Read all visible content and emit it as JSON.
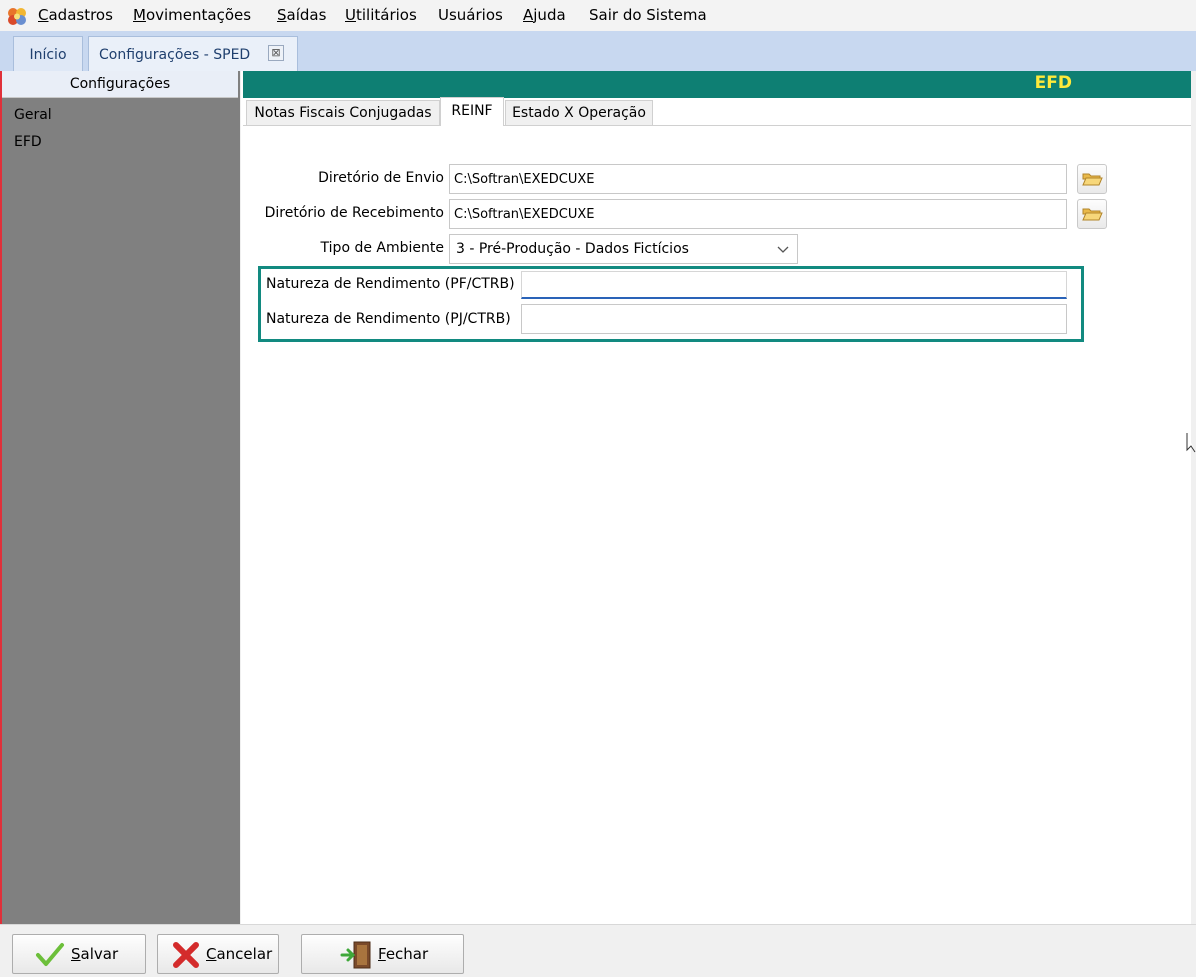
{
  "menu": {
    "items": [
      {
        "first": "C",
        "rest": "adastros"
      },
      {
        "first": "M",
        "rest": "ovimentações"
      },
      {
        "first": "S",
        "rest": "aídas"
      },
      {
        "first": "U",
        "rest": "tilitários"
      },
      {
        "first": "",
        "rest": "Usuários"
      },
      {
        "first": "A",
        "rest": "juda"
      },
      {
        "first": "",
        "rest": "Sair do Sistema"
      }
    ]
  },
  "tabs": {
    "home": "Início",
    "config_sped": "Configurações - SPED",
    "close_glyph": "⊠"
  },
  "sidebar": {
    "header": "Configurações",
    "items": [
      "Geral",
      "EFD"
    ]
  },
  "panel": {
    "title": "EFD",
    "subtabs": [
      "Notas Fiscais Conjugadas",
      "REINF",
      "Estado X Operação"
    ]
  },
  "form": {
    "diretorio_envio": {
      "label": "Diretório de Envio",
      "value": "C:\\Softran\\EXEDCUXE"
    },
    "diretorio_recebimento": {
      "label": "Diretório de Recebimento",
      "value": "C:\\Softran\\EXEDCUXE"
    },
    "tipo_ambiente": {
      "label": "Tipo de Ambiente",
      "value": "3 - Pré-Produção - Dados Fictícios"
    },
    "natureza_pf": {
      "label": "Natureza de Rendimento (PF/CTRB)",
      "value": ""
    },
    "natureza_pj": {
      "label": "Natureza de Rendimento (PJ/CTRB)",
      "value": ""
    }
  },
  "buttons": {
    "salvar": {
      "first": "S",
      "rest": "alvar"
    },
    "cancelar": {
      "first": "C",
      "rest": "ancelar"
    },
    "fechar": {
      "first": "F",
      "rest": "echar"
    }
  },
  "colors": {
    "accent_teal": "#0e7f73",
    "title_yellow": "#ffea3b",
    "highlight": "#128a80"
  }
}
